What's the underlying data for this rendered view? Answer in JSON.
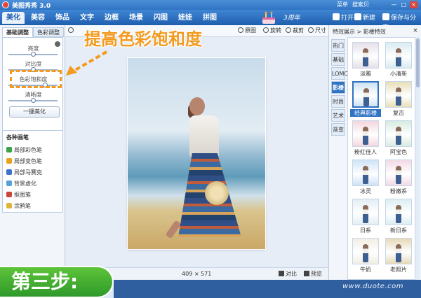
{
  "window": {
    "title": "美图秀秀 3.0",
    "menu": [
      "菜单",
      "搜索贝"
    ],
    "controls": [
      "—",
      "□",
      "×"
    ]
  },
  "main_tabs": [
    {
      "label": "美化",
      "active": true
    },
    {
      "label": "美容",
      "active": false
    },
    {
      "label": "饰品",
      "active": false
    },
    {
      "label": "文字",
      "active": false
    },
    {
      "label": "边框",
      "active": false
    },
    {
      "label": "场景",
      "active": false
    },
    {
      "label": "闪图",
      "active": false
    },
    {
      "label": "娃娃",
      "active": false
    },
    {
      "label": "拼图",
      "active": false
    }
  ],
  "anniversary": "3周年",
  "top_actions": {
    "open": "打开",
    "new": "新建",
    "save_share": "保存与分享"
  },
  "left_panel": {
    "tabs": [
      {
        "label": "基础调整",
        "active": true
      },
      {
        "label": "色彩调整",
        "active": false
      }
    ],
    "sliders": [
      {
        "label": "亮度",
        "value": 0.5
      },
      {
        "label": "对比度",
        "value": 0.5
      },
      {
        "label": "色彩饱和度",
        "value": 0.75
      },
      {
        "label": "清晰度",
        "value": 0.5
      }
    ],
    "one_click": "一键美化",
    "brushes_title": "各种画笔",
    "brushes": [
      {
        "label": "局部彩色笔",
        "color": "#3aa34a"
      },
      {
        "label": "局部变色笔",
        "color": "#e8a21e"
      },
      {
        "label": "局部马赛克",
        "color": "#3a73c8"
      },
      {
        "label": "背景虚化",
        "color": "#5aa0d8"
      },
      {
        "label": "抠图笔",
        "color": "#c9463a"
      },
      {
        "label": "涂鸦笔",
        "color": "#e0b43a"
      }
    ]
  },
  "toolbar": {
    "zoom_icon": "magnifier-icon",
    "original": "原图",
    "rotate": "旋转",
    "crop": "裁剪",
    "resize": "尺寸"
  },
  "status": {
    "size_text": "409 × 571",
    "compare": "对比",
    "preview": "预览"
  },
  "right_panel": {
    "header": "特效展示 > 影楼特效",
    "categories": [
      {
        "label": "热门",
        "active": false
      },
      {
        "label": "基础",
        "active": false
      },
      {
        "label": "LOMO",
        "active": false
      },
      {
        "label": "影楼",
        "active": true
      },
      {
        "label": "时尚",
        "active": false
      },
      {
        "label": "艺术",
        "active": false
      },
      {
        "label": "渐变",
        "active": false
      }
    ],
    "effects": [
      {
        "label": "淡雅",
        "active": false,
        "tint": "#e6dfe8"
      },
      {
        "label": "小清新",
        "active": false,
        "tint": "#d8ecf2"
      },
      {
        "label": "经典影楼",
        "active": true,
        "tint": "#cfe3f2"
      },
      {
        "label": "复古",
        "active": false,
        "tint": "#e8dfb6"
      },
      {
        "label": "粉红佳人",
        "active": false,
        "tint": "#f3d6de"
      },
      {
        "label": "阿宝色",
        "active": false,
        "tint": "#d6ebe0"
      },
      {
        "label": "冰灵",
        "active": false,
        "tint": "#cfe2f6"
      },
      {
        "label": "粉嫩系",
        "active": false,
        "tint": "#f2dae6"
      },
      {
        "label": "日系",
        "active": false,
        "tint": "#e2eef4"
      },
      {
        "label": "新日系",
        "active": false,
        "tint": "#dceef2"
      },
      {
        "label": "牛奶",
        "active": false,
        "tint": "#f2eee4"
      },
      {
        "label": "老照片",
        "active": false,
        "tint": "#e6d9b8"
      }
    ]
  },
  "annotation": "提高色彩饱和度",
  "step_banner": "第三步:",
  "watermark": "www.duote.com"
}
